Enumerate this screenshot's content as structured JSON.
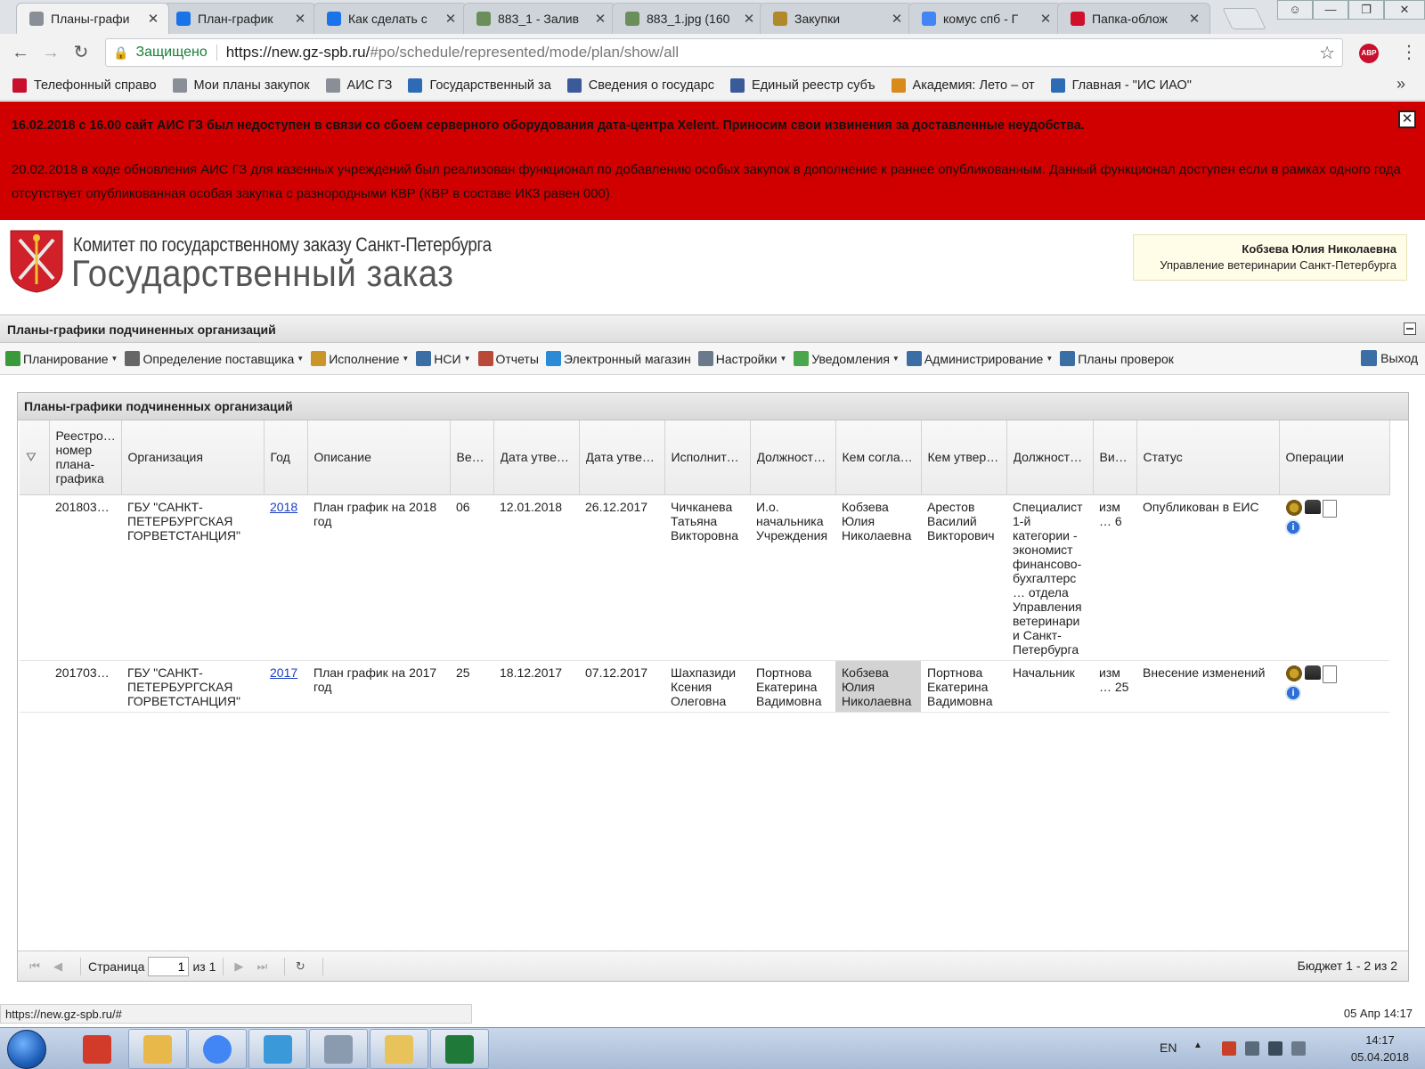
{
  "browser": {
    "tabs": [
      {
        "title": "Планы-графи",
        "color": "#8a8f97",
        "active": true
      },
      {
        "title": "План-график",
        "color": "#1a73e8"
      },
      {
        "title": "Как сделать с",
        "color": "#1a73e8"
      },
      {
        "title": "883_1 - Залив",
        "color": "#6a8f5a"
      },
      {
        "title": "883_1.jpg (160",
        "color": "#6a8f5a"
      },
      {
        "title": "Закупки",
        "color": "#b08a2a"
      },
      {
        "title": "комус спб - Г",
        "color": "#4285f4"
      },
      {
        "title": "Папка-облож",
        "color": "#d0102a"
      }
    ],
    "secure_label": "Защищено",
    "url_host": "https://new.gz-spb.ru/",
    "url_path": "#po/schedule/represented/mode/plan/show/all",
    "abp_label": "ABP",
    "bookmarks": [
      {
        "label": "Телефонный справо",
        "color": "#c8102e"
      },
      {
        "label": "Мои планы закупок",
        "color": "#8a8f97"
      },
      {
        "label": "АИС ГЗ",
        "color": "#8a8f97"
      },
      {
        "label": "Государственный за",
        "color": "#2d6bb5"
      },
      {
        "label": "Сведения о государс",
        "color": "#3b5a9a"
      },
      {
        "label": "Единый реестр субъ",
        "color": "#3b5a9a"
      },
      {
        "label": "Академия: Лето – от",
        "color": "#d88a1a"
      },
      {
        "label": "Главная - \"ИС ИАО\"",
        "color": "#2d6bb5"
      }
    ],
    "more": "»"
  },
  "notice": {
    "line1": "16.02.2018 с 16.00 сайт АИС ГЗ был недоступен в связи со сбоем серверного оборудования дата-центра Xelent. Приносим свои извинения за доставленные неудобства.",
    "line2": "20.02.2018 в ходе обновления АИС ГЗ для казенных учреждений был реализован функционал по добавлению особых закупок в дополнение к раннее опубликованным. Данный функционал доступен если в рамках одного года отсутствует опубликованная особая закупка с разнородными КВР (КВР в составе ИКЗ равен 000).",
    "close": "✕",
    "bg": "#d00000"
  },
  "header": {
    "org_line1": "Комитет по государственному заказу Санкт-Петербурга",
    "org_line2": "Государственный заказ"
  },
  "user": {
    "name": "Кобзева Юлия Николаевна",
    "org": "Управление ветеринарии Санкт-Петербурга"
  },
  "section": {
    "title": "Планы-графики подчиненных организаций"
  },
  "menu": [
    {
      "label": "Планирование",
      "dropdown": true,
      "color": "#3a9a3a"
    },
    {
      "label": "Определение поставщика",
      "dropdown": true,
      "color": "#666666"
    },
    {
      "label": "Исполнение",
      "dropdown": true,
      "color": "#c9962a"
    },
    {
      "label": "НСИ",
      "dropdown": true,
      "color": "#3a6ea5"
    },
    {
      "label": "Отчеты",
      "dropdown": false,
      "color": "#b84a3a"
    },
    {
      "label": "Электронный магазин",
      "dropdown": false,
      "color": "#2a8ad6"
    },
    {
      "label": "Настройки",
      "dropdown": true,
      "color": "#6a7a8a"
    },
    {
      "label": "Уведомления",
      "dropdown": true,
      "color": "#4aa64a"
    },
    {
      "label": "Администрирование",
      "dropdown": true,
      "color": "#3a6ea5"
    },
    {
      "label": "Планы проверок",
      "dropdown": false,
      "color": "#3a6ea5"
    }
  ],
  "logout_label": "Выход",
  "grid": {
    "title": "Планы-графики подчиненных организаций",
    "columns": [
      "",
      "Реестро… номер плана-графика",
      "Организация",
      "Год",
      "Описание",
      "Ве…",
      "Дата утвер…",
      "Дата утвер…",
      "Исполнитель",
      "Должность…",
      "Кем соглас…",
      "Кем утвер…",
      "Должность…",
      "Ви…",
      "Статус",
      "Операции"
    ],
    "rows": [
      {
        "reg": "2018037…",
        "org": "ГБУ \"САНКТ-ПЕТЕРБУРГСКАЯ ГОРВЕТСТАНЦИЯ\"",
        "year": "2018",
        "desc": "План график на 2018 год",
        "ver": "06",
        "d1": "12.01.2018",
        "d2": "26.12.2017",
        "exec": "Чичканева Татьяна Викторовна",
        "pos": "И.о. начальника Учреждения",
        "agreed": "Кобзева Юлия Николаевна",
        "approved": "Арестов Василий Викторович",
        "pos2": "Специалист 1-й категории - экономист финансово-бухгалтерс… отдела Управления ветеринарии Санкт-Петербурга",
        "kind": "изм… 6",
        "status": "Опубликован в ЕИС"
      },
      {
        "reg": "2017037…",
        "org": "ГБУ \"САНКТ-ПЕТЕРБУРГСКАЯ ГОРВЕТСТАНЦИЯ\"",
        "year": "2017",
        "desc": "План график на 2017 год",
        "ver": "25",
        "d1": "18.12.2017",
        "d2": "07.12.2017",
        "exec": "Шахпазиди Ксения Олеговна",
        "pos": "Портнова Екатерина Вадимовна",
        "agreed": "Кобзева Юлия Николаевна",
        "approved": "Портнова Екатерина Вадимовна",
        "pos2": "Начальник",
        "kind": "изм… 25",
        "status": "Внесение изменений"
      }
    ]
  },
  "pager": {
    "page_label": "Страница",
    "page_value": "1",
    "of_label": "из 1",
    "total": "Бюджет 1 - 2 из 2"
  },
  "status_url": "https://new.gz-spb.ru/#",
  "status_datetime": "05 Апр 14:17",
  "taskbar": {
    "lang": "EN",
    "time": "14:17",
    "date": "05.04.2018",
    "apps": [
      {
        "name": "ccleaner",
        "color": "#d23a2a"
      },
      {
        "name": "outlook",
        "color": "#e8b84a"
      },
      {
        "name": "chrome",
        "color": "#4285f4"
      },
      {
        "name": "ie",
        "color": "#3a9ad9"
      },
      {
        "name": "calculator",
        "color": "#8a9bb0"
      },
      {
        "name": "explorer",
        "color": "#e8c25a"
      },
      {
        "name": "excel",
        "color": "#1f7a3a"
      }
    ]
  }
}
